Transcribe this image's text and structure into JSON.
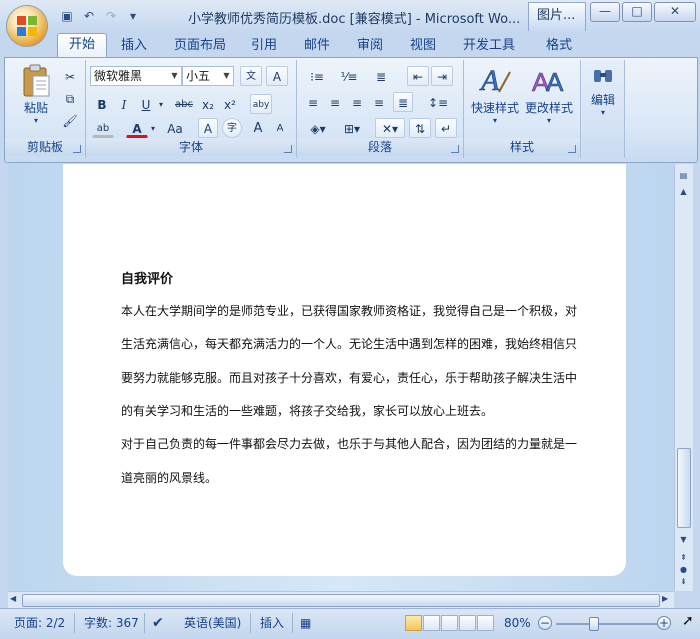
{
  "window": {
    "title": "小学教师优秀简历模板.doc [兼容模式] - Microsoft Wo...",
    "picture_tools_tab": "图片...",
    "minimize": "—",
    "maximize": "□",
    "close": "✕"
  },
  "quick_access": {
    "save": "💾",
    "undo": "↶",
    "redo": "↷",
    "customize": "▾"
  },
  "tabs": [
    "开始",
    "插入",
    "页面布局",
    "引用",
    "邮件",
    "审阅",
    "视图",
    "开发工具",
    "格式"
  ],
  "help": "?",
  "clipboard": {
    "paste_label": "粘贴",
    "group_label": "剪贴板"
  },
  "font": {
    "font_name": "微软雅黑",
    "font_size": "小五",
    "group_label": "字体",
    "bold": "B",
    "italic": "I",
    "underline": "U",
    "strike": "abc",
    "subscript": "x₂",
    "superscript": "x²",
    "clear": "aby",
    "grow": "A",
    "shrink": "A",
    "change_case": "Aa",
    "char_border": "A",
    "phonetic": "文",
    "enclose": "字",
    "highlight": "ab",
    "font_color": "A"
  },
  "paragraph": {
    "group_label": "段落"
  },
  "styles": {
    "quick_styles_label": "快速样式",
    "change_styles_label": "更改样式",
    "group_label": "样式"
  },
  "editing": {
    "label": "编辑"
  },
  "document": {
    "heading": "自我评价",
    "lines": [
      "本人在大学期间学的是师范专业，已获得国家教师资格证，我觉得自己是一个积极，对",
      "生活充满信心，每天都充满活力的一个人。无论生活中遇到怎样的困难，我始终相信只",
      "要努力就能够克服。而且对孩子十分喜欢，有爱心，责任心，乐于帮助孩子解决生活中",
      "的有关学习和生活的一些难题，将孩子交给我，家长可以放心上班去。",
      "对于自己负责的每一件事都会尽力去做，也乐于与其他人配合，因为团结的力量就是一",
      "道亮丽的风景线。"
    ]
  },
  "status": {
    "page": "页面: 2/2",
    "words": "字数: 367",
    "language": "英语(美国)",
    "insert_mode": "插入",
    "zoom": "80%",
    "zoom_out": "−",
    "zoom_in": "+"
  }
}
